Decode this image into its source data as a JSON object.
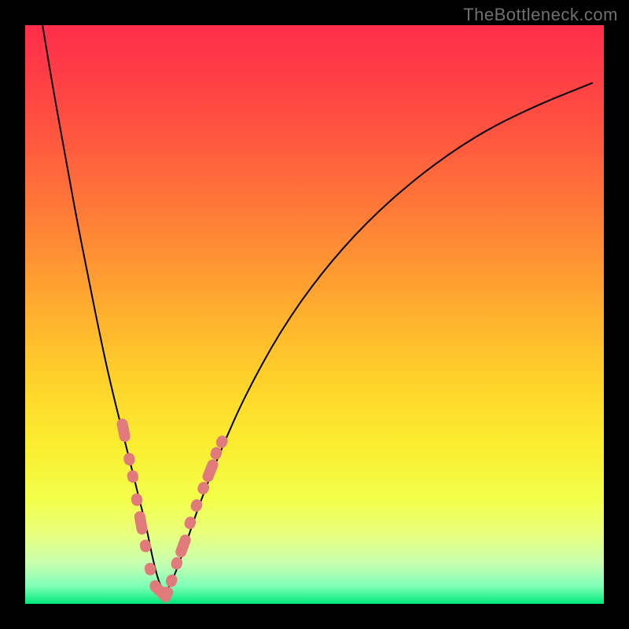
{
  "watermark": "TheBottleneck.com",
  "chart_data": {
    "type": "line",
    "title": "",
    "xlabel": "",
    "ylabel": "",
    "xlim": [
      0,
      100
    ],
    "ylim": [
      0,
      100
    ],
    "series": [
      {
        "name": "bottleneck-curve",
        "x": [
          3,
          5,
          7,
          9,
          11,
          13,
          15,
          17,
          18,
          19,
          20,
          21,
          22,
          23,
          24,
          25,
          27,
          30,
          34,
          38,
          44,
          51,
          59,
          68,
          78,
          88,
          98
        ],
        "y": [
          100,
          88,
          77,
          66,
          56,
          46,
          37,
          29,
          25,
          21,
          17,
          13,
          8,
          4,
          2,
          3,
          8,
          17,
          27,
          36,
          47,
          57,
          66,
          74,
          81,
          86,
          90
        ]
      }
    ],
    "markers": {
      "name": "highlight-range",
      "color": "#e17b7b",
      "points": [
        {
          "x": 17.0,
          "y": 30
        },
        {
          "x": 18.0,
          "y": 25
        },
        {
          "x": 18.6,
          "y": 22
        },
        {
          "x": 19.3,
          "y": 18
        },
        {
          "x": 20.0,
          "y": 14
        },
        {
          "x": 20.8,
          "y": 10
        },
        {
          "x": 21.6,
          "y": 6
        },
        {
          "x": 22.5,
          "y": 3
        },
        {
          "x": 23.5,
          "y": 2
        },
        {
          "x": 24.5,
          "y": 2
        },
        {
          "x": 25.3,
          "y": 4
        },
        {
          "x": 26.2,
          "y": 7
        },
        {
          "x": 27.3,
          "y": 10
        },
        {
          "x": 28.5,
          "y": 14
        },
        {
          "x": 29.6,
          "y": 17
        },
        {
          "x": 30.8,
          "y": 20
        },
        {
          "x": 32.0,
          "y": 23
        },
        {
          "x": 33.0,
          "y": 26
        },
        {
          "x": 34.0,
          "y": 28
        }
      ]
    },
    "gradient_stops": [
      {
        "pos": 0.0,
        "color": "#ff2d4a"
      },
      {
        "pos": 0.07,
        "color": "#ff3a47"
      },
      {
        "pos": 0.18,
        "color": "#ff5340"
      },
      {
        "pos": 0.32,
        "color": "#ff7a38"
      },
      {
        "pos": 0.46,
        "color": "#ffa430"
      },
      {
        "pos": 0.6,
        "color": "#ffce2a"
      },
      {
        "pos": 0.72,
        "color": "#fbec2f"
      },
      {
        "pos": 0.82,
        "color": "#f3ff4a"
      },
      {
        "pos": 0.88,
        "color": "#e8ff7d"
      },
      {
        "pos": 0.93,
        "color": "#c7ffb1"
      },
      {
        "pos": 0.97,
        "color": "#7dffb8"
      },
      {
        "pos": 1.0,
        "color": "#00e87a"
      }
    ]
  }
}
